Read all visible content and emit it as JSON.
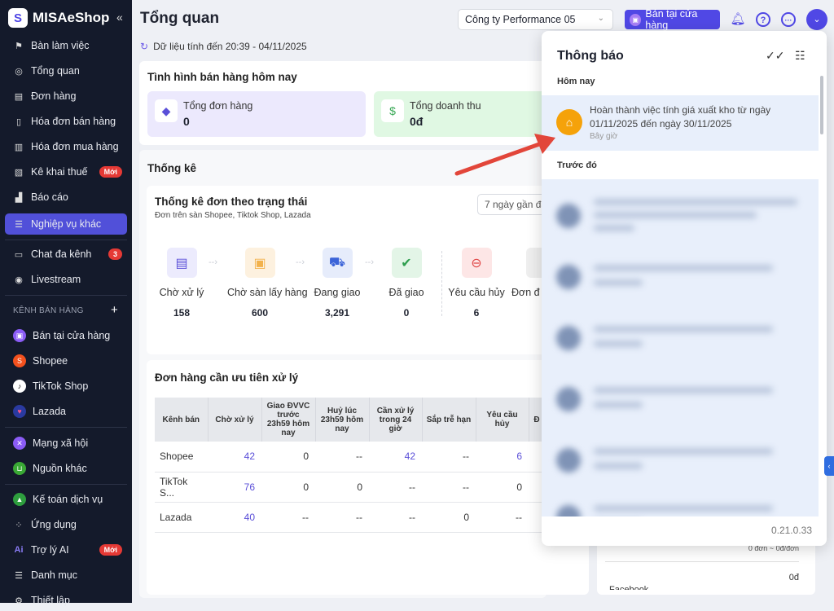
{
  "sidebar": {
    "brand": "MISAeShop",
    "items": [
      {
        "label": "Bàn làm việc"
      },
      {
        "label": "Tổng quan"
      },
      {
        "label": "Đơn hàng"
      },
      {
        "label": "Hóa đơn bán hàng"
      },
      {
        "label": "Hóa đơn mua hàng"
      },
      {
        "label": "Kê khai thuế",
        "badge": "Mới"
      },
      {
        "label": "Báo cáo"
      },
      {
        "label": "Nghiệp vụ khác"
      },
      {
        "label": "Chat đa kênh",
        "badge": "3"
      },
      {
        "label": "Livestream"
      }
    ],
    "section_title": "KÊNH BÁN HÀNG",
    "channels": [
      {
        "label": "Bán tại cửa hàng",
        "color": "#8b5cf6"
      },
      {
        "label": "Shopee",
        "color": "#f4511e"
      },
      {
        "label": "TikTok Shop",
        "color": "#ffffff"
      },
      {
        "label": "Lazada",
        "color": "#2a3aa0"
      }
    ],
    "others": [
      {
        "label": "Mạng xã hội",
        "color": "#8b5cf6"
      },
      {
        "label": "Nguồn khác",
        "color": "#3aa935"
      }
    ],
    "bottom": [
      {
        "label": "Kế toán dịch vụ"
      },
      {
        "label": "Ứng dụng"
      },
      {
        "label": "Trợ lý AI",
        "badge": "Mới"
      },
      {
        "label": "Danh mục"
      },
      {
        "label": "Thiết lập"
      }
    ]
  },
  "header": {
    "title": "Tổng quan",
    "updated": "Dữ liệu tính đến 20:39 - 04/11/2025",
    "company": "Công ty Performance 05",
    "store_button": "Bán tại cửa hàng"
  },
  "today": {
    "title": "Tình hình bán hàng hôm nay",
    "orders_label": "Tổng đơn hàng",
    "orders": "0",
    "revenue_label": "Tổng doanh thu",
    "revenue": "0đ"
  },
  "stats": {
    "title": "Thống kê",
    "card_title": "Thống kê đơn theo trạng thái",
    "card_sub": "Đơn trên sàn Shopee, Tiktok Shop, Lazada",
    "range": "7 ngày gần đây",
    "statuses": [
      {
        "label": "Chờ xử lý",
        "value": "158"
      },
      {
        "label": "Chờ sàn lấy hàng",
        "value": "600"
      },
      {
        "label": "Đang giao",
        "value": "3,291"
      },
      {
        "label": "Đã giao",
        "value": "0"
      },
      {
        "label": "Yêu cầu hủy",
        "value": "6"
      },
      {
        "label": "Đơn đ"
      }
    ]
  },
  "priority": {
    "title": "Đơn hàng cần ưu tiên xử lý",
    "columns": [
      "Kênh bán",
      "Chờ xử lý",
      "Giao ĐVVC trước 23h59 hôm nay",
      "Huỷ lúc 23h59 hôm nay",
      "Cần xử lý trong 24 giờ",
      "Sắp trễ hạn",
      "Yêu cầu hủy",
      "Đ"
    ],
    "rows": [
      [
        "Shopee",
        "42",
        "0",
        "--",
        "42",
        "--",
        "6"
      ],
      [
        "TikTok S...",
        "76",
        "0",
        "0",
        "--",
        "--",
        "0"
      ],
      [
        "Lazada",
        "40",
        "--",
        "--",
        "--",
        "0",
        "--"
      ]
    ]
  },
  "right_card": {
    "avg": "0 đơn ~ 0đ/đơn",
    "amount": "0đ",
    "channel": "Facebook"
  },
  "notifications": {
    "title": "Thông báo",
    "today_label": "Hôm nay",
    "item": {
      "text1": "Hoàn thành việc tính giá xuất kho từ ngày",
      "text2": "01/11/2025 đến ngày 30/11/2025",
      "time": "Bây giờ"
    },
    "earlier_label": "Trước đó",
    "version": "0.21.0.33"
  }
}
